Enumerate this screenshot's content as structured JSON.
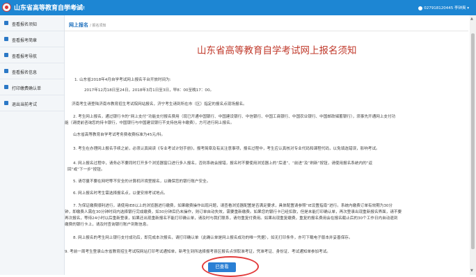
{
  "header": {
    "title": "山东省高等教育自学考试",
    "subtitle": "网上报名系统",
    "user": "027918120445 李钟爽 ▾",
    "colors": {
      "bar": "#1d86d3",
      "accent_red": "#c0392b"
    }
  },
  "sidebar": {
    "items": [
      {
        "label": "查看报名须知",
        "icon": "notice-icon"
      },
      {
        "label": "查看报考简章",
        "icon": "brochure-icon"
      },
      {
        "label": "查看报考导航",
        "icon": "bookmark-icon"
      },
      {
        "label": "查看报名信息",
        "icon": "info-icon"
      },
      {
        "label": "打印缴费确认单",
        "icon": "print-icon"
      },
      {
        "label": "退出当前考试",
        "icon": "exit-icon"
      }
    ]
  },
  "breadcrumb": {
    "main": "网上报名",
    "sub": "/ 报名须知"
  },
  "notice": {
    "title": "山东省高等教育自学考试网上报名须知",
    "paragraphs": [
      "1. 山东省2018年4月自学考试网上报名平台开放时间为:",
      "2017年12月18日至24日，2018年3月1日至3日，早8：00至晚17：00。",
      "济南考生请登陆济南市教育招生考试院网站报名，济宁考生请到所在市（区）指定的报名点现场报名。",
      "2. 考生网上报名，通过银行卡的“网上支付”功能支付报名费用（现已开通中国银行、中国建设银行、中信银行、中国工商银行、中国农业银行、中国邮政储蓄银行），须事先开通网上支付功",
      "能（请提前咨询您的持卡银行，中国银行与中国建设银行不支持信用卡缴费），方可进行网上报名。",
      "山东省高等教育自学考试考务费收费标准为45元/科。",
      "3. 考生在办理网上报名手续之前，必须认真阅读《专业考试计划手册》，报考简章及有关注意事项，报名过程中，考生应认真核对专业代码和课程代码，以免填选错误，影响考试。",
      "4. 网上报名过程中，请务必不要同时打开多个浏览器窗口进行多人报名，否则系统会报错，报名时不要使用浏览器上的“后退”、“前进”及“刷新”按钮，请使用报名系统内的“返",
      "回”或“下一步”按钮。",
      "5. 请尽量不要在网吧等不安全的计算机环境里报名，以确保您的银行账户安全。",
      "6. 网上报名时考生需选择报名点，以便安排考试地点。",
      "7. 为保证缴费顺利进行，请使用IE8以上的浏览器进行缴费，如果缴费操作出现问题，请查看浏览器配置是否满足要求，具体配置请参照“IE设置指南”进行。系统内缴费订单有效期为30分",
      "钟，即缴费人需在30分钟时间内选择银行完成缴费，如30分钟后仍未操作，则订单自动失效，需要重新缴费。如果您的银行卡已经扣款，但是未能打印确认单，再次登录出现重新报名界面，请不要",
      "再次报名，等待24小时以后重新登录，如果还出现重新报名不能打印确认单，请及时与我们联系，请勿重复付费用。如果出现重复缴费，重复的报名费用会在报名截止后的30个工作日内自动退到",
      "缴费的银行卡上，请及时查询银行账户到账信息。",
      "8. 网上报名的考生网上银行支付成功后，即完成本次报名，请打印确认单（此确认单是网上报名成功的唯一凭据），如无打印条件，亦可下载电子版本并妥善保存。",
      "9. 考前一周考生登录山东省教育招生考试院网站打印考试通知单，新考生到所选择报考县区报名点领取准考证，凭准考证、身份证、考试通知单参加考试。"
    ]
  },
  "actions": {
    "confirm": "已查看"
  }
}
